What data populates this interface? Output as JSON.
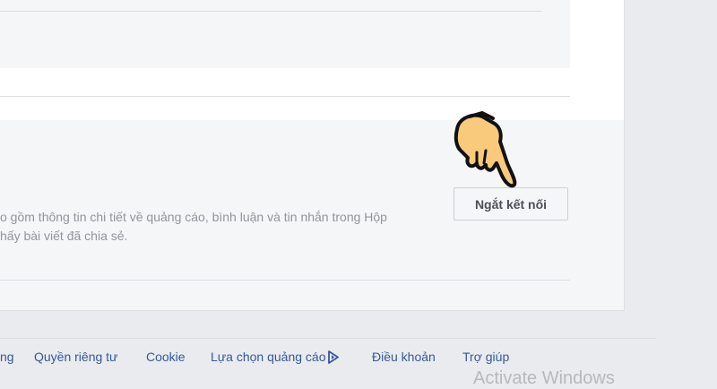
{
  "description": {
    "line1": "o gồm thông tin chi tiết về quảng cáo, bình luận và tin nhắn trong Hộp",
    "line2": "hấy bài viết đã chia sẻ."
  },
  "disconnect_button": {
    "label": "Ngắt kết nối"
  },
  "footer": {
    "links": [
      "ng",
      "Quyền riêng tư",
      "Cookie",
      "Lựa chọn quảng cáo",
      "Điều khoản",
      "Trợ giúp"
    ],
    "adchoices_icon": "adchoices-triangle-icon"
  },
  "watermark": "Activate Windows",
  "colors": {
    "link": "#365899",
    "panel_grey": "#f5f6f7",
    "page_bg": "#e9ebee",
    "hand_fill": "#f9c97c"
  },
  "pointer_icon": "pointing-hand-icon"
}
